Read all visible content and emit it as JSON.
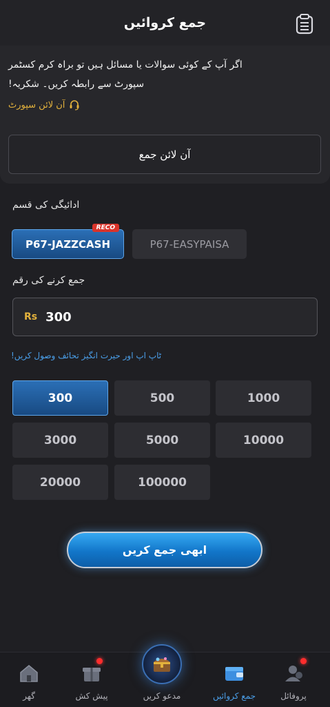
{
  "header": {
    "title": "جمع کروائیں",
    "records_icon": "clipboard-list-icon"
  },
  "info_card": {
    "message_line1": "اگر آپ کے کوئی سوالات یا مسائل ہیں تو براہ کرم کسٹمر",
    "message_line2": "سپورٹ سے رابطہ کریں۔ شکریہ!",
    "support_link": "آن لائن سپورٹ",
    "support_icon": "headset-icon",
    "online_deposit_button": "آن لائن جمع"
  },
  "payment": {
    "label": "ادائیگی کی قسم",
    "methods": [
      {
        "label": "P67-JAZZCASH",
        "badge": "RECO",
        "selected": true
      },
      {
        "label": "P67-EASYPAISA",
        "selected": false
      }
    ]
  },
  "amount": {
    "label": "جمع کرنے کی رقم",
    "currency": "Rs",
    "value": "300",
    "promo": "ٹاپ اپ اور حیرت انگیز تحائف وصول کریں!"
  },
  "amount_options": [
    "300",
    "500",
    "1000",
    "3000",
    "5000",
    "10000",
    "20000",
    "100000"
  ],
  "selected_amount": "300",
  "deposit_button": "ابھی جمع کریں",
  "tabbar": {
    "items": [
      {
        "label": "گھر",
        "icon": "home-icon",
        "badge": false
      },
      {
        "label": "پیش کش",
        "icon": "gift-icon",
        "badge": true
      },
      {
        "label": "مدعو کریں",
        "icon": "treasure-chest-icon",
        "badge": false
      },
      {
        "label": "جمع کروائیں",
        "icon": "wallet-icon",
        "badge": false,
        "active": true
      },
      {
        "label": "پروفائل",
        "icon": "user-icon",
        "badge": true
      }
    ]
  },
  "colors": {
    "accent_blue": "#4a9ee8",
    "gold": "#e3b23c",
    "badge_red": "#d9342b"
  }
}
